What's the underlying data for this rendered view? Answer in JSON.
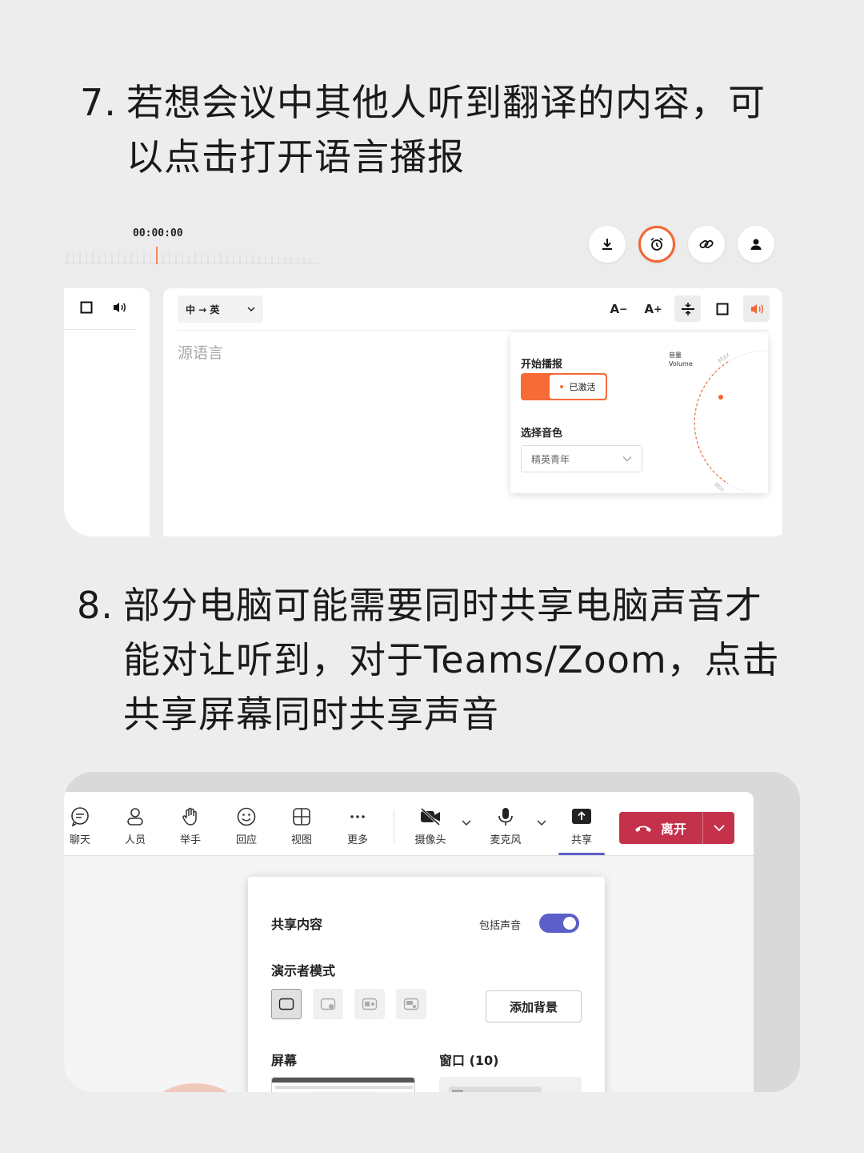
{
  "step7": {
    "number": "7.",
    "line1": "若想会议中其他人听到翻译的内容，可",
    "line2": "以点击打开语言播报"
  },
  "step8": {
    "number": "8.",
    "line1": "部分电脑可能需要同时共享电脑声音才",
    "line2": "能对让听到，对于Teams/Zoom，点击",
    "line3": "共享屏幕同时共享声音"
  },
  "translator": {
    "timecode": "00:00:00",
    "lang_select": "中 → 英",
    "source_placeholder": "源语言",
    "font_smaller": "A",
    "font_larger": "A",
    "broadcast": {
      "start_label": "开始播报",
      "status": "已激活",
      "voice_label": "选择音色",
      "voice_value": "精英青年",
      "volume_label_cn": "音量",
      "volume_label_en": "Volume",
      "dial_max": "Max",
      "dial_min": "Min"
    },
    "accent_color": "#f26633"
  },
  "teams": {
    "toolbar": [
      {
        "label": "聊天",
        "icon": "chat-icon"
      },
      {
        "label": "人员",
        "icon": "people-icon"
      },
      {
        "label": "举手",
        "icon": "raise-hand-icon"
      },
      {
        "label": "回应",
        "icon": "emoji-icon"
      },
      {
        "label": "视图",
        "icon": "grid-view-icon"
      },
      {
        "label": "更多",
        "icon": "more-icon"
      },
      {
        "label": "摄像头",
        "icon": "camera-off-icon"
      },
      {
        "label": "麦克风",
        "icon": "mic-icon"
      },
      {
        "label": "共享",
        "icon": "share-icon"
      }
    ],
    "leave_label": "离开",
    "leave_color": "#c4314b",
    "share_panel": {
      "title": "共享内容",
      "include_audio_label": "包括声音",
      "include_audio_on": true,
      "presenter_mode_label": "演示者模式",
      "add_background": "添加背景",
      "screen_label": "屏幕",
      "window_label": "窗口 (10)"
    },
    "accent_color": "#5b5fc7"
  }
}
